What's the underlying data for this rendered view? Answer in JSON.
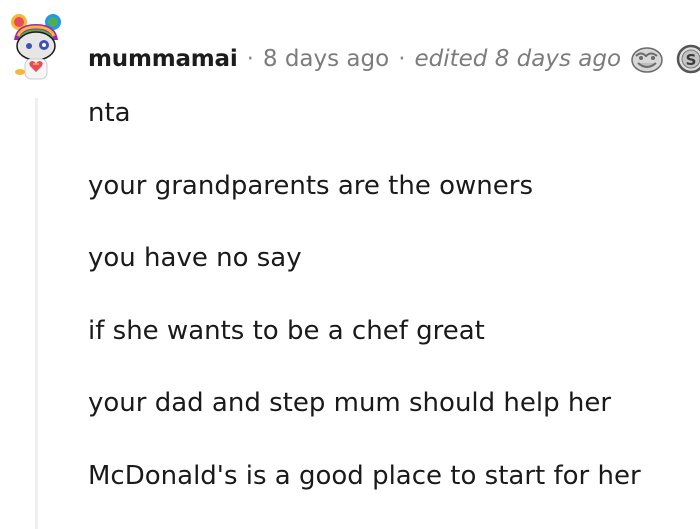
{
  "comment": {
    "author": "mummamai",
    "separator": "·",
    "timestamp": "8 days ago",
    "edited": "edited 8 days ago",
    "awards": [
      {
        "icon": "hugz-award-icon"
      },
      {
        "icon": "silver-award-icon",
        "glyph": "S"
      }
    ],
    "lines": [
      "nta",
      "your grandparents are the owners",
      "you have no say",
      "if she wants to be a chef great",
      "your dad and step mum should help her",
      "McDonald's is a good place to start for her"
    ]
  },
  "colors": {
    "text": "#1a1a1b",
    "meta": "#7c7c7c",
    "thread_line": "#edeff1",
    "avatar_face": "#e6e6e6",
    "avatar_hair": [
      "#e84a5f",
      "#f7b733",
      "#4caf50",
      "#2196f3",
      "#9c27b0"
    ]
  }
}
